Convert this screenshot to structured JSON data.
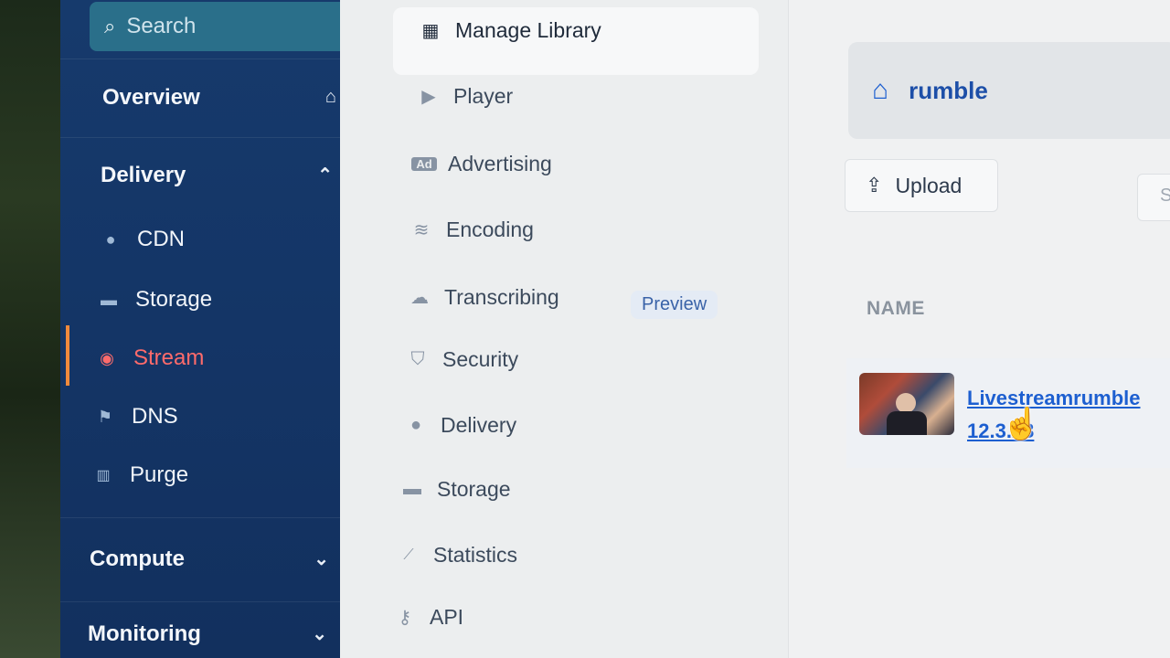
{
  "sidebar": {
    "search_placeholder": "Search",
    "sections": [
      {
        "label": "Overview",
        "icon": "home-icon",
        "glyph": "⌂"
      },
      {
        "label": "Delivery",
        "icon": "chevron-up-icon",
        "glyph": "⌃"
      },
      {
        "label": "Compute",
        "icon": "chevron-down-icon",
        "glyph": "⌄"
      },
      {
        "label": "Monitoring",
        "icon": "chevron-down-icon",
        "glyph": "⌄"
      }
    ],
    "delivery_items": [
      {
        "label": "CDN",
        "icon": "map-pin-icon",
        "glyph": "●"
      },
      {
        "label": "Storage",
        "icon": "storage-icon",
        "glyph": "▬"
      },
      {
        "label": "Stream",
        "icon": "play-circle-icon",
        "glyph": "◉",
        "active": true
      },
      {
        "label": "DNS",
        "icon": "flag-icon",
        "glyph": "⚑"
      },
      {
        "label": "Purge",
        "icon": "trash-icon",
        "glyph": "🗑"
      }
    ]
  },
  "subnav": {
    "items": [
      {
        "label": "Manage Library",
        "icon": "film-icon",
        "glyph": "▦",
        "selected": true
      },
      {
        "label": "Player",
        "icon": "play-icon",
        "glyph": "▶"
      },
      {
        "label": "Advertising",
        "icon": "ad-icon",
        "glyph": "Ad"
      },
      {
        "label": "Encoding",
        "icon": "waveform-icon",
        "glyph": "≋"
      },
      {
        "label": "Transcribing",
        "icon": "cloud-icon",
        "glyph": "☁"
      },
      {
        "label": "Security",
        "icon": "shield-icon",
        "glyph": "⛉"
      },
      {
        "label": "Delivery",
        "icon": "map-pin-icon",
        "glyph": "●"
      },
      {
        "label": "Storage",
        "icon": "storage-icon",
        "glyph": "▬"
      },
      {
        "label": "Statistics",
        "icon": "chart-icon",
        "glyph": "📈"
      },
      {
        "label": "API",
        "icon": "key-icon",
        "glyph": "⚷"
      }
    ],
    "preview_badge": "Preview"
  },
  "main": {
    "breadcrumb": {
      "library": "rumble",
      "home_glyph": "⌂"
    },
    "upload_label": "Upload",
    "upload_glyph": "⇪",
    "second_button_label": "S",
    "column_header": "NAME",
    "videos": [
      {
        "title": "Livestreamrumble 12.3.23"
      }
    ],
    "cursor_glyph": "☝"
  }
}
